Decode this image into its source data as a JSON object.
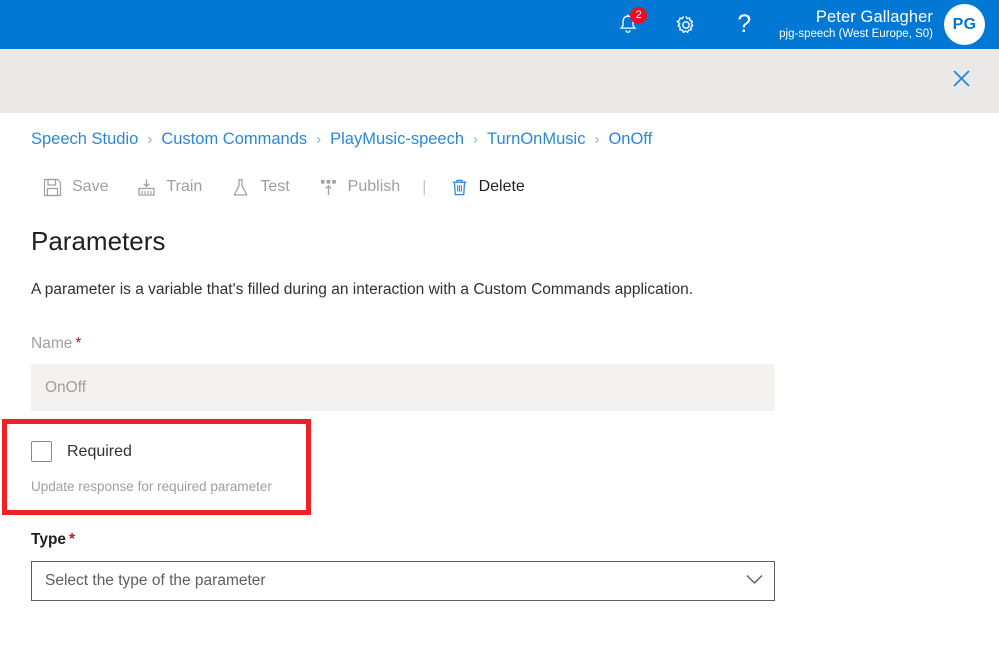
{
  "topbar": {
    "notifications": {
      "icon": "bell-icon",
      "count": "2"
    },
    "settings": {
      "icon": "gear-icon"
    },
    "help": {
      "icon": "question-mark-icon",
      "glyph": "?"
    },
    "user": {
      "name": "Peter Gallagher",
      "subscription": "pjg-speech (West Europe, S0)",
      "initials": "PG"
    },
    "accent_color": "#0078d4",
    "badge_color": "#e81123"
  },
  "subbar": {
    "close_icon": "close-icon",
    "background": "#ebe9e8"
  },
  "breadcrumb": {
    "separator": "›",
    "items": [
      {
        "label": "Speech Studio"
      },
      {
        "label": "Custom Commands"
      },
      {
        "label": "PlayMusic-speech"
      },
      {
        "label": "TurnOnMusic"
      },
      {
        "label": "OnOff"
      }
    ],
    "link_color": "#2b88d8"
  },
  "commandbar": {
    "separator": "|",
    "commands": [
      {
        "label": "Save",
        "icon": "save-floppy-icon",
        "enabled": false
      },
      {
        "label": "Train",
        "icon": "train-model-icon",
        "enabled": false
      },
      {
        "label": "Test",
        "icon": "flask-icon",
        "enabled": false
      },
      {
        "label": "Publish",
        "icon": "publish-upload-icon",
        "enabled": false
      },
      {
        "label": "Delete",
        "icon": "trash-icon",
        "enabled": true
      }
    ]
  },
  "main": {
    "title": "Parameters",
    "description": "A parameter is a variable that's filled during an interaction with a Custom Commands application.",
    "name_field": {
      "label": "Name",
      "required_marker": "*",
      "value": "OnOff",
      "disabled": true
    },
    "required_field": {
      "checkbox_label": "Required",
      "checked": false,
      "help_text": "Update response for required parameter",
      "highlight_color": "#ee2222"
    },
    "type_field": {
      "label": "Type",
      "required_marker": "*",
      "placeholder": "Select the type of the parameter",
      "chevron_icon": "chevron-down-icon"
    }
  }
}
